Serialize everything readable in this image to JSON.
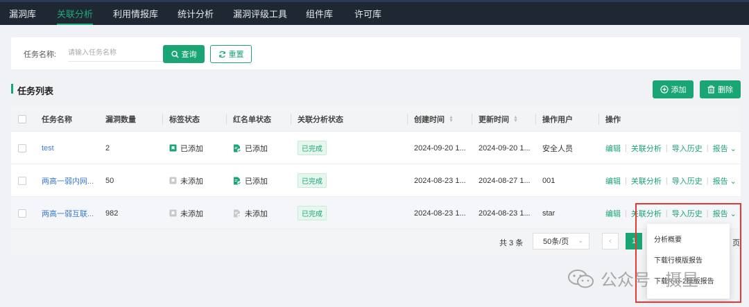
{
  "nav": {
    "items": [
      "漏洞库",
      "关联分析",
      "利用情报库",
      "统计分析",
      "漏洞评级工具",
      "组件库",
      "许可库"
    ],
    "active_index": 1
  },
  "search": {
    "label": "任务名称:",
    "placeholder": "请输入任务名称",
    "value": "",
    "query_label": "查询",
    "reset_label": "重置"
  },
  "list": {
    "title": "任务列表",
    "add_label": "添加",
    "delete_label": "删除"
  },
  "table": {
    "columns": [
      "任务名称",
      "漏洞数量",
      "标签状态",
      "红名单状态",
      "关联分析状态",
      "创建时间",
      "更新时间",
      "操作用户",
      "操作"
    ],
    "rows": [
      {
        "name": "test",
        "count": "2",
        "tag_status": "已添加",
        "tag_added": true,
        "red_status": "已添加",
        "red_added": true,
        "analysis": "已完成",
        "created": "2024-09-20 1...",
        "updated": "2024-09-20 1...",
        "user": "安全人员"
      },
      {
        "name": "两高一弱内网...",
        "count": "50",
        "tag_status": "未添加",
        "tag_added": false,
        "red_status": "已添加",
        "red_added": true,
        "analysis": "已完成",
        "created": "2024-08-23 1...",
        "updated": "2024-08-27 1...",
        "user": "001"
      },
      {
        "name": "两高一弱互联...",
        "count": "982",
        "tag_status": "未添加",
        "tag_added": false,
        "red_status": "未添加",
        "red_added": false,
        "analysis": "已完成",
        "created": "2024-08-23 1...",
        "updated": "2024-08-23 1...",
        "user": "star"
      }
    ],
    "actions": [
      "编辑",
      "关联分析",
      "导入历史",
      "报告"
    ],
    "hover_row_index": 2
  },
  "pagination": {
    "total": "共 3 条",
    "page_size": "50条/页",
    "current_page": "1",
    "tail": "页"
  },
  "report_menu": {
    "options": [
      "分析概要",
      "下载行模版报告",
      "下载R-R-2模版报告"
    ]
  },
  "watermark": {
    "text": "公众号 · 摄星"
  },
  "colors": {
    "brand": "#1aa574",
    "nav_bg": "#1f2733",
    "link": "#3b7bd6",
    "highlight_box": "#e53935"
  }
}
